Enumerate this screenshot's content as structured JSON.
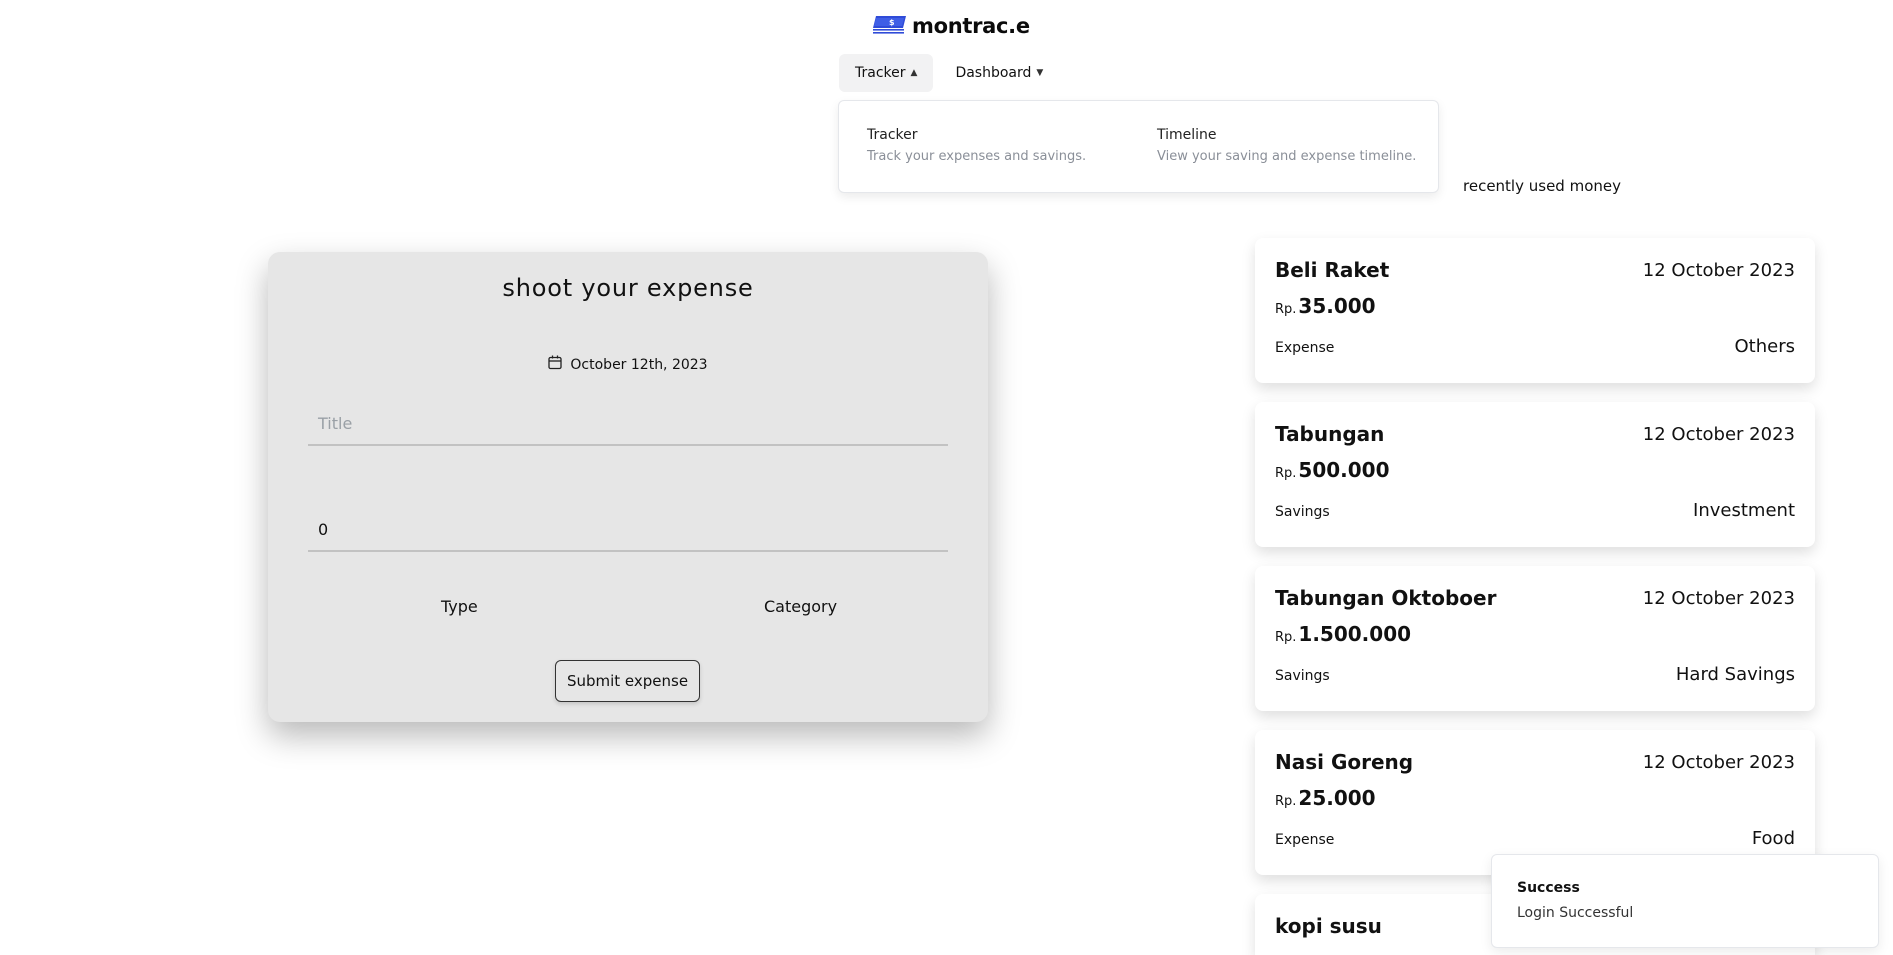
{
  "brand": {
    "name": "montrac.e",
    "logo_icon": "money-stack-logo",
    "accent": "#2f4bd8"
  },
  "nav": {
    "tabs": [
      {
        "label": "Tracker",
        "icon": "chevron-up-icon"
      },
      {
        "label": "Dashboard",
        "icon": "chevron-down-icon"
      }
    ],
    "dropdown": [
      {
        "title": "Tracker",
        "desc": "Track your expenses and savings."
      },
      {
        "title": "Timeline",
        "desc": "View your saving and expense timeline."
      }
    ]
  },
  "form": {
    "heading": "shoot your expense",
    "date": "October 12th, 2023",
    "title_placeholder": "Title",
    "amount_value": "0",
    "type_label": "Type",
    "category_label": "Category",
    "submit_label": "Submit expense"
  },
  "recent": {
    "label": "recently used money",
    "currency": "Rp.",
    "items": [
      {
        "title": "Beli Raket",
        "date": "12 October 2023",
        "amount": "35.000",
        "type": "Expense",
        "category": "Others"
      },
      {
        "title": "Tabungan",
        "date": "12 October 2023",
        "amount": "500.000",
        "type": "Savings",
        "category": "Investment"
      },
      {
        "title": "Tabungan Oktoboer",
        "date": "12 October 2023",
        "amount": "1.500.000",
        "type": "Savings",
        "category": "Hard Savings"
      },
      {
        "title": "Nasi Goreng",
        "date": "12 October 2023",
        "amount": "25.000",
        "type": "Expense",
        "category": "Food"
      },
      {
        "title": "kopi susu"
      }
    ]
  },
  "toast": {
    "title": "Success",
    "message": "Login Successful"
  }
}
